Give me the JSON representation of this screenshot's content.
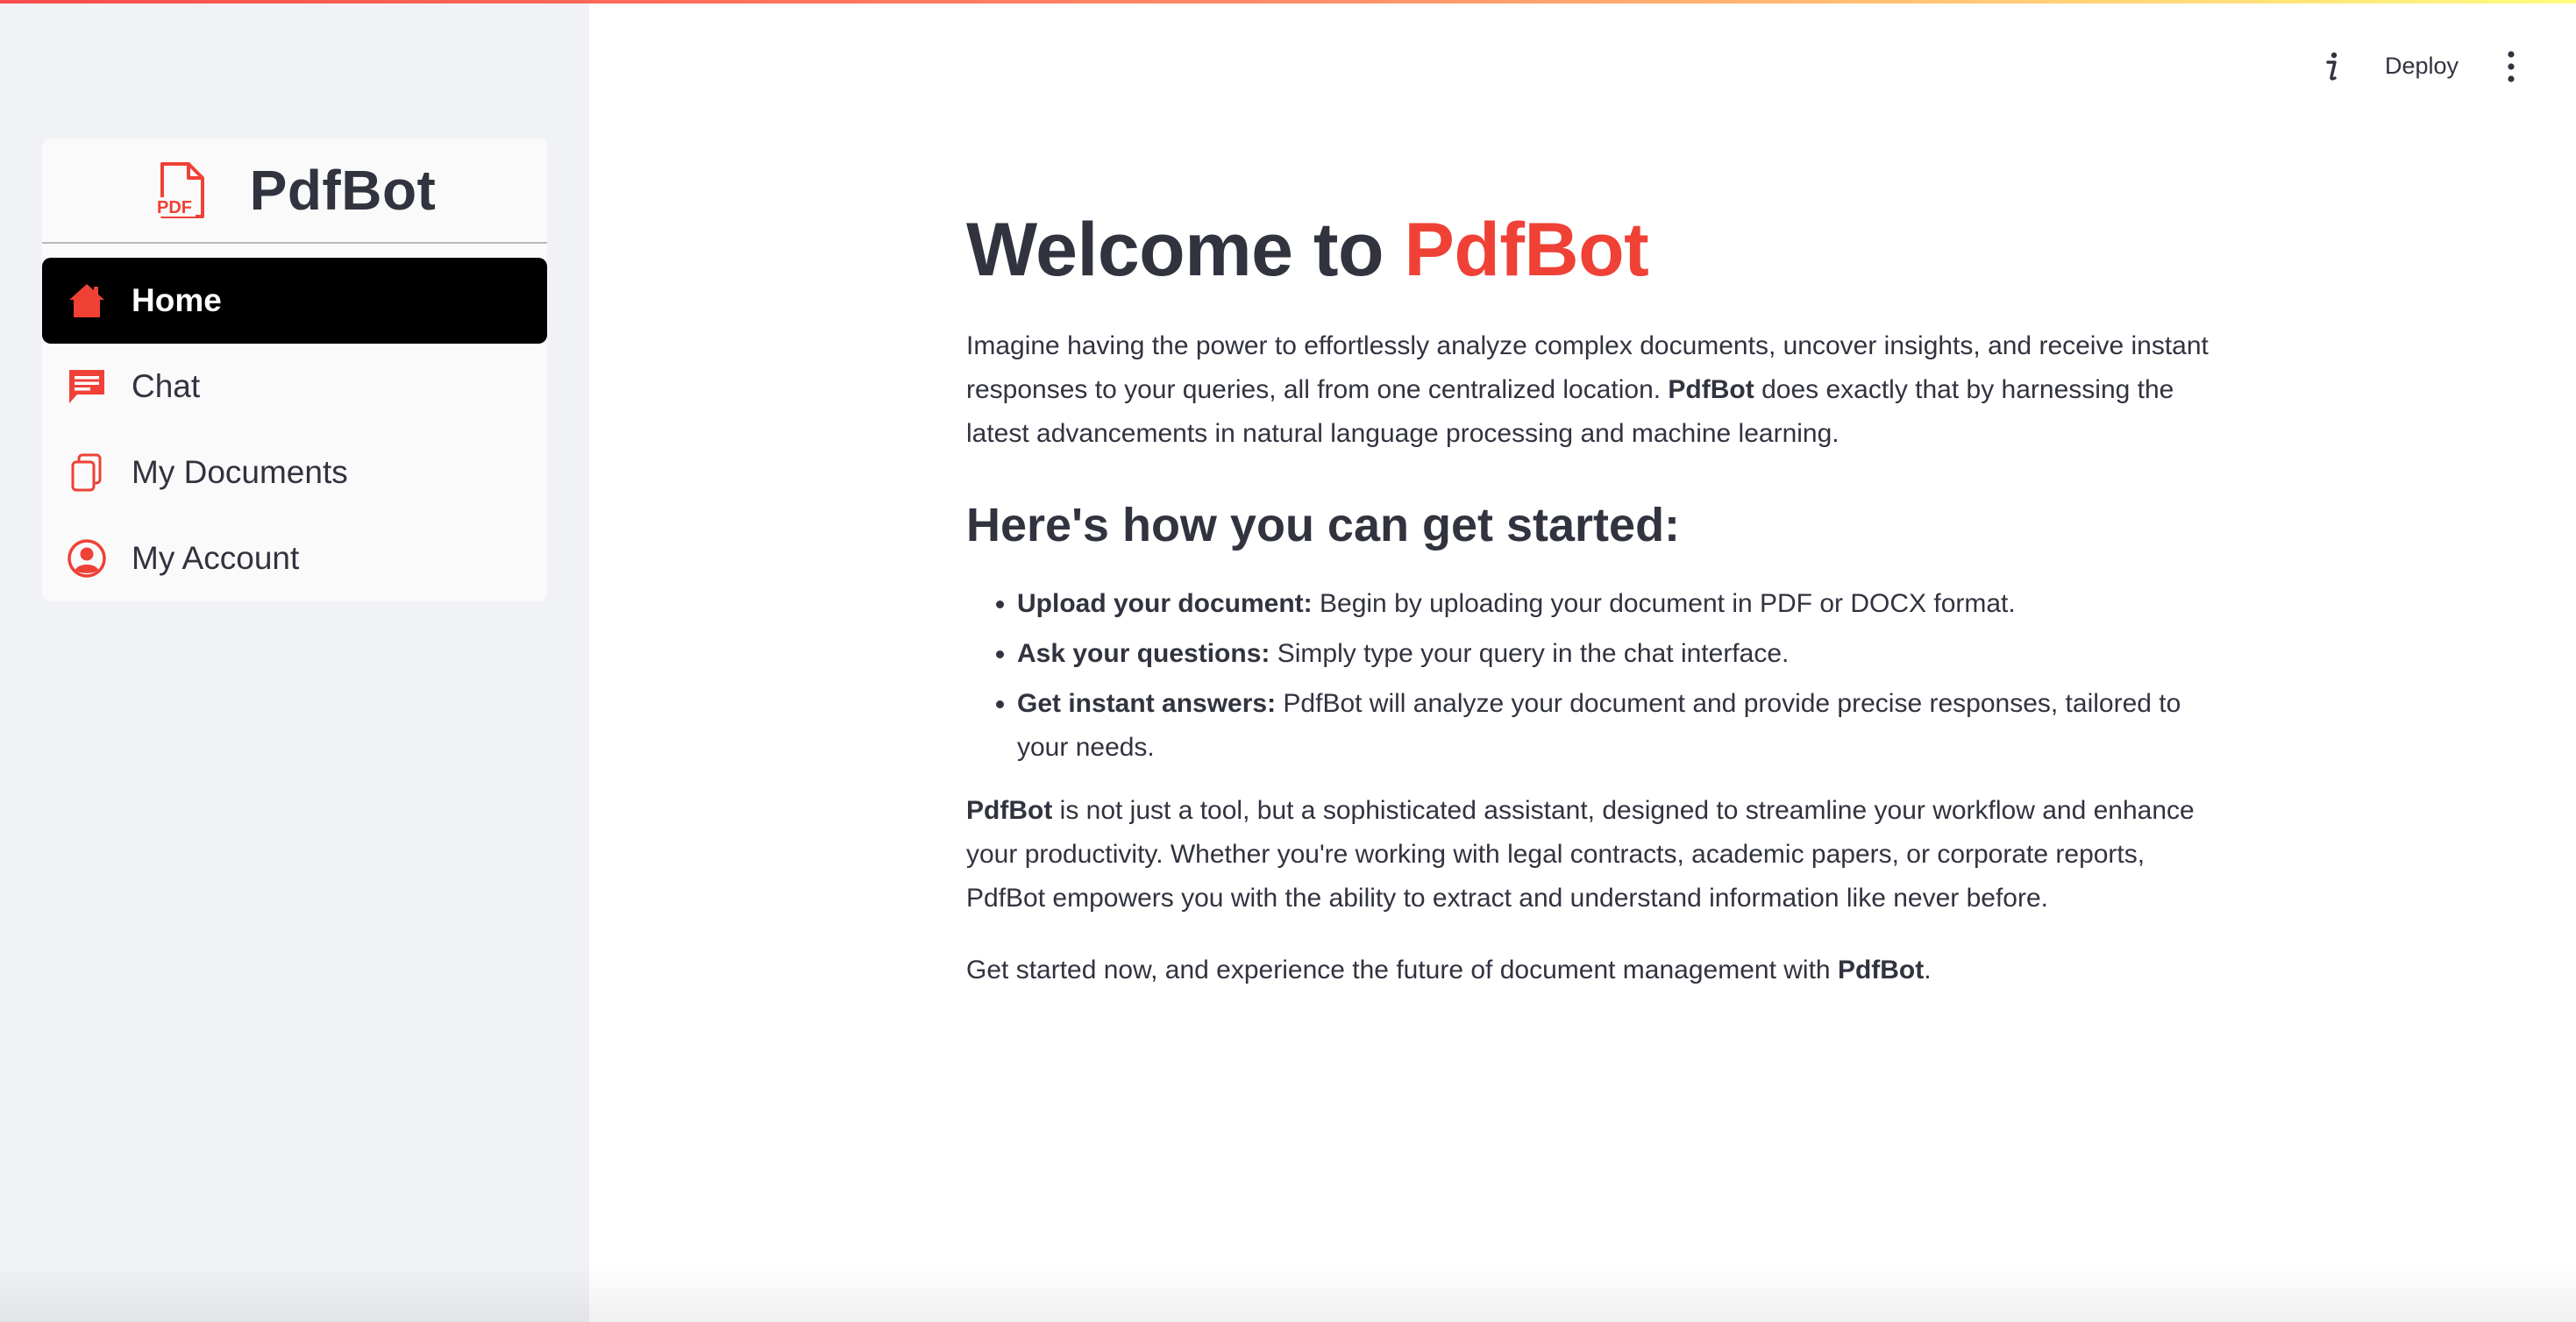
{
  "sidebar": {
    "menu_title": "PdfBot",
    "logo_icon_text": "PDF",
    "items": [
      {
        "label": "Home",
        "icon": "home-icon",
        "active": true
      },
      {
        "label": "Chat",
        "icon": "chat-icon",
        "active": false
      },
      {
        "label": "My Documents",
        "icon": "documents-icon",
        "active": false
      },
      {
        "label": "My Account",
        "icon": "account-icon",
        "active": false
      }
    ]
  },
  "toolbar": {
    "info_icon": "info-icon",
    "deploy_label": "Deploy",
    "menu_icon": "kebab-menu-icon"
  },
  "main": {
    "welcome_prefix": "Welcome to ",
    "welcome_brand": "PdfBot",
    "intro": {
      "before": "Imagine having the power to effortlessly analyze complex documents, uncover insights, and receive instant responses to your queries, all from one centralized location. ",
      "bold": "PdfBot",
      "after": " does exactly that by harnessing the latest advancements in natural language processing and machine learning."
    },
    "started_heading": "Here's how you can get started:",
    "steps": [
      {
        "title": "Upload your document:",
        "text": " Begin by uploading your document in PDF or DOCX format."
      },
      {
        "title": "Ask your questions:",
        "text": " Simply type your query in the chat interface."
      },
      {
        "title": "Get instant answers:",
        "text": " PdfBot will analyze your document and provide precise responses, tailored to your needs."
      }
    ],
    "closing": {
      "bold": "PdfBot",
      "after": " is not just a tool, but a sophisticated assistant, designed to streamline your workflow and enhance your productivity. Whether you're working with legal contracts, academic papers, or corporate reports, PdfBot empowers you with the ability to extract and understand information like never before."
    },
    "final": {
      "before": "Get started now, and experience the future of document management with ",
      "bold": "PdfBot",
      "after": "."
    }
  },
  "colors": {
    "brand_red": "#ef4136",
    "sidebar_bg": "#f0f2f6",
    "active_item_bg": "#000000",
    "text": "#31333f"
  }
}
